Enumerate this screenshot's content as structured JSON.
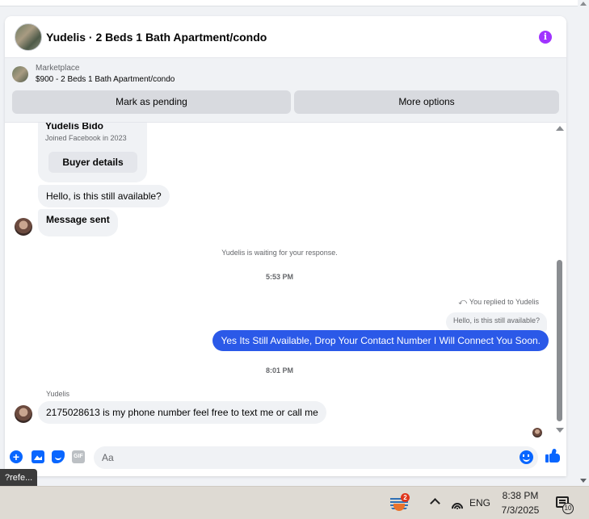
{
  "conversation": {
    "title": "Yudelis · 2 Beds 1 Bath Apartment/condo",
    "info_icon": "info-icon",
    "info_glyph": "i"
  },
  "listing": {
    "category": "Marketplace",
    "price_title": "$900 - 2 Beds 1 Bath Apartment/condo",
    "buttons": {
      "mark_pending": "Mark as pending",
      "more_options": "More options"
    }
  },
  "buyer_card": {
    "name": "Yudelis Bido",
    "joined": "Joined Facebook in 2023",
    "button": "Buyer details"
  },
  "messages": {
    "incoming_1": "Hello, is this still available?",
    "incoming_2": "Message sent",
    "waiting_note": "Yudelis is waiting for your response.",
    "time_1": "5:53 PM",
    "replied_label": "You replied to Yudelis",
    "quoted_text": "Hello, is this still available?",
    "outgoing": "Yes Its Still Available, Drop Your Contact Number I Will Connect You Soon.",
    "time_2": "8:01 PM",
    "sender_label": "Yudelis",
    "incoming_3": "2175028613 is my phone number feel free to text me or call me"
  },
  "composer": {
    "placeholder": "Aa",
    "plus_glyph": "+",
    "gif_label": "GIF",
    "icons": [
      "plus-icon",
      "photo-icon",
      "sticker-icon",
      "gif-icon",
      "emoji-icon",
      "like-icon"
    ]
  },
  "tooltip": "?refe...",
  "taskbar": {
    "app_badge": "2",
    "language": "ENG",
    "time": "8:38 PM",
    "date": "7/3/2025",
    "notification_count": "10"
  },
  "colors": {
    "accent": "#0866ff",
    "outgoing_bubble": "#2b59e8",
    "info": "#a033ff",
    "taskbar": "#dedad3"
  }
}
